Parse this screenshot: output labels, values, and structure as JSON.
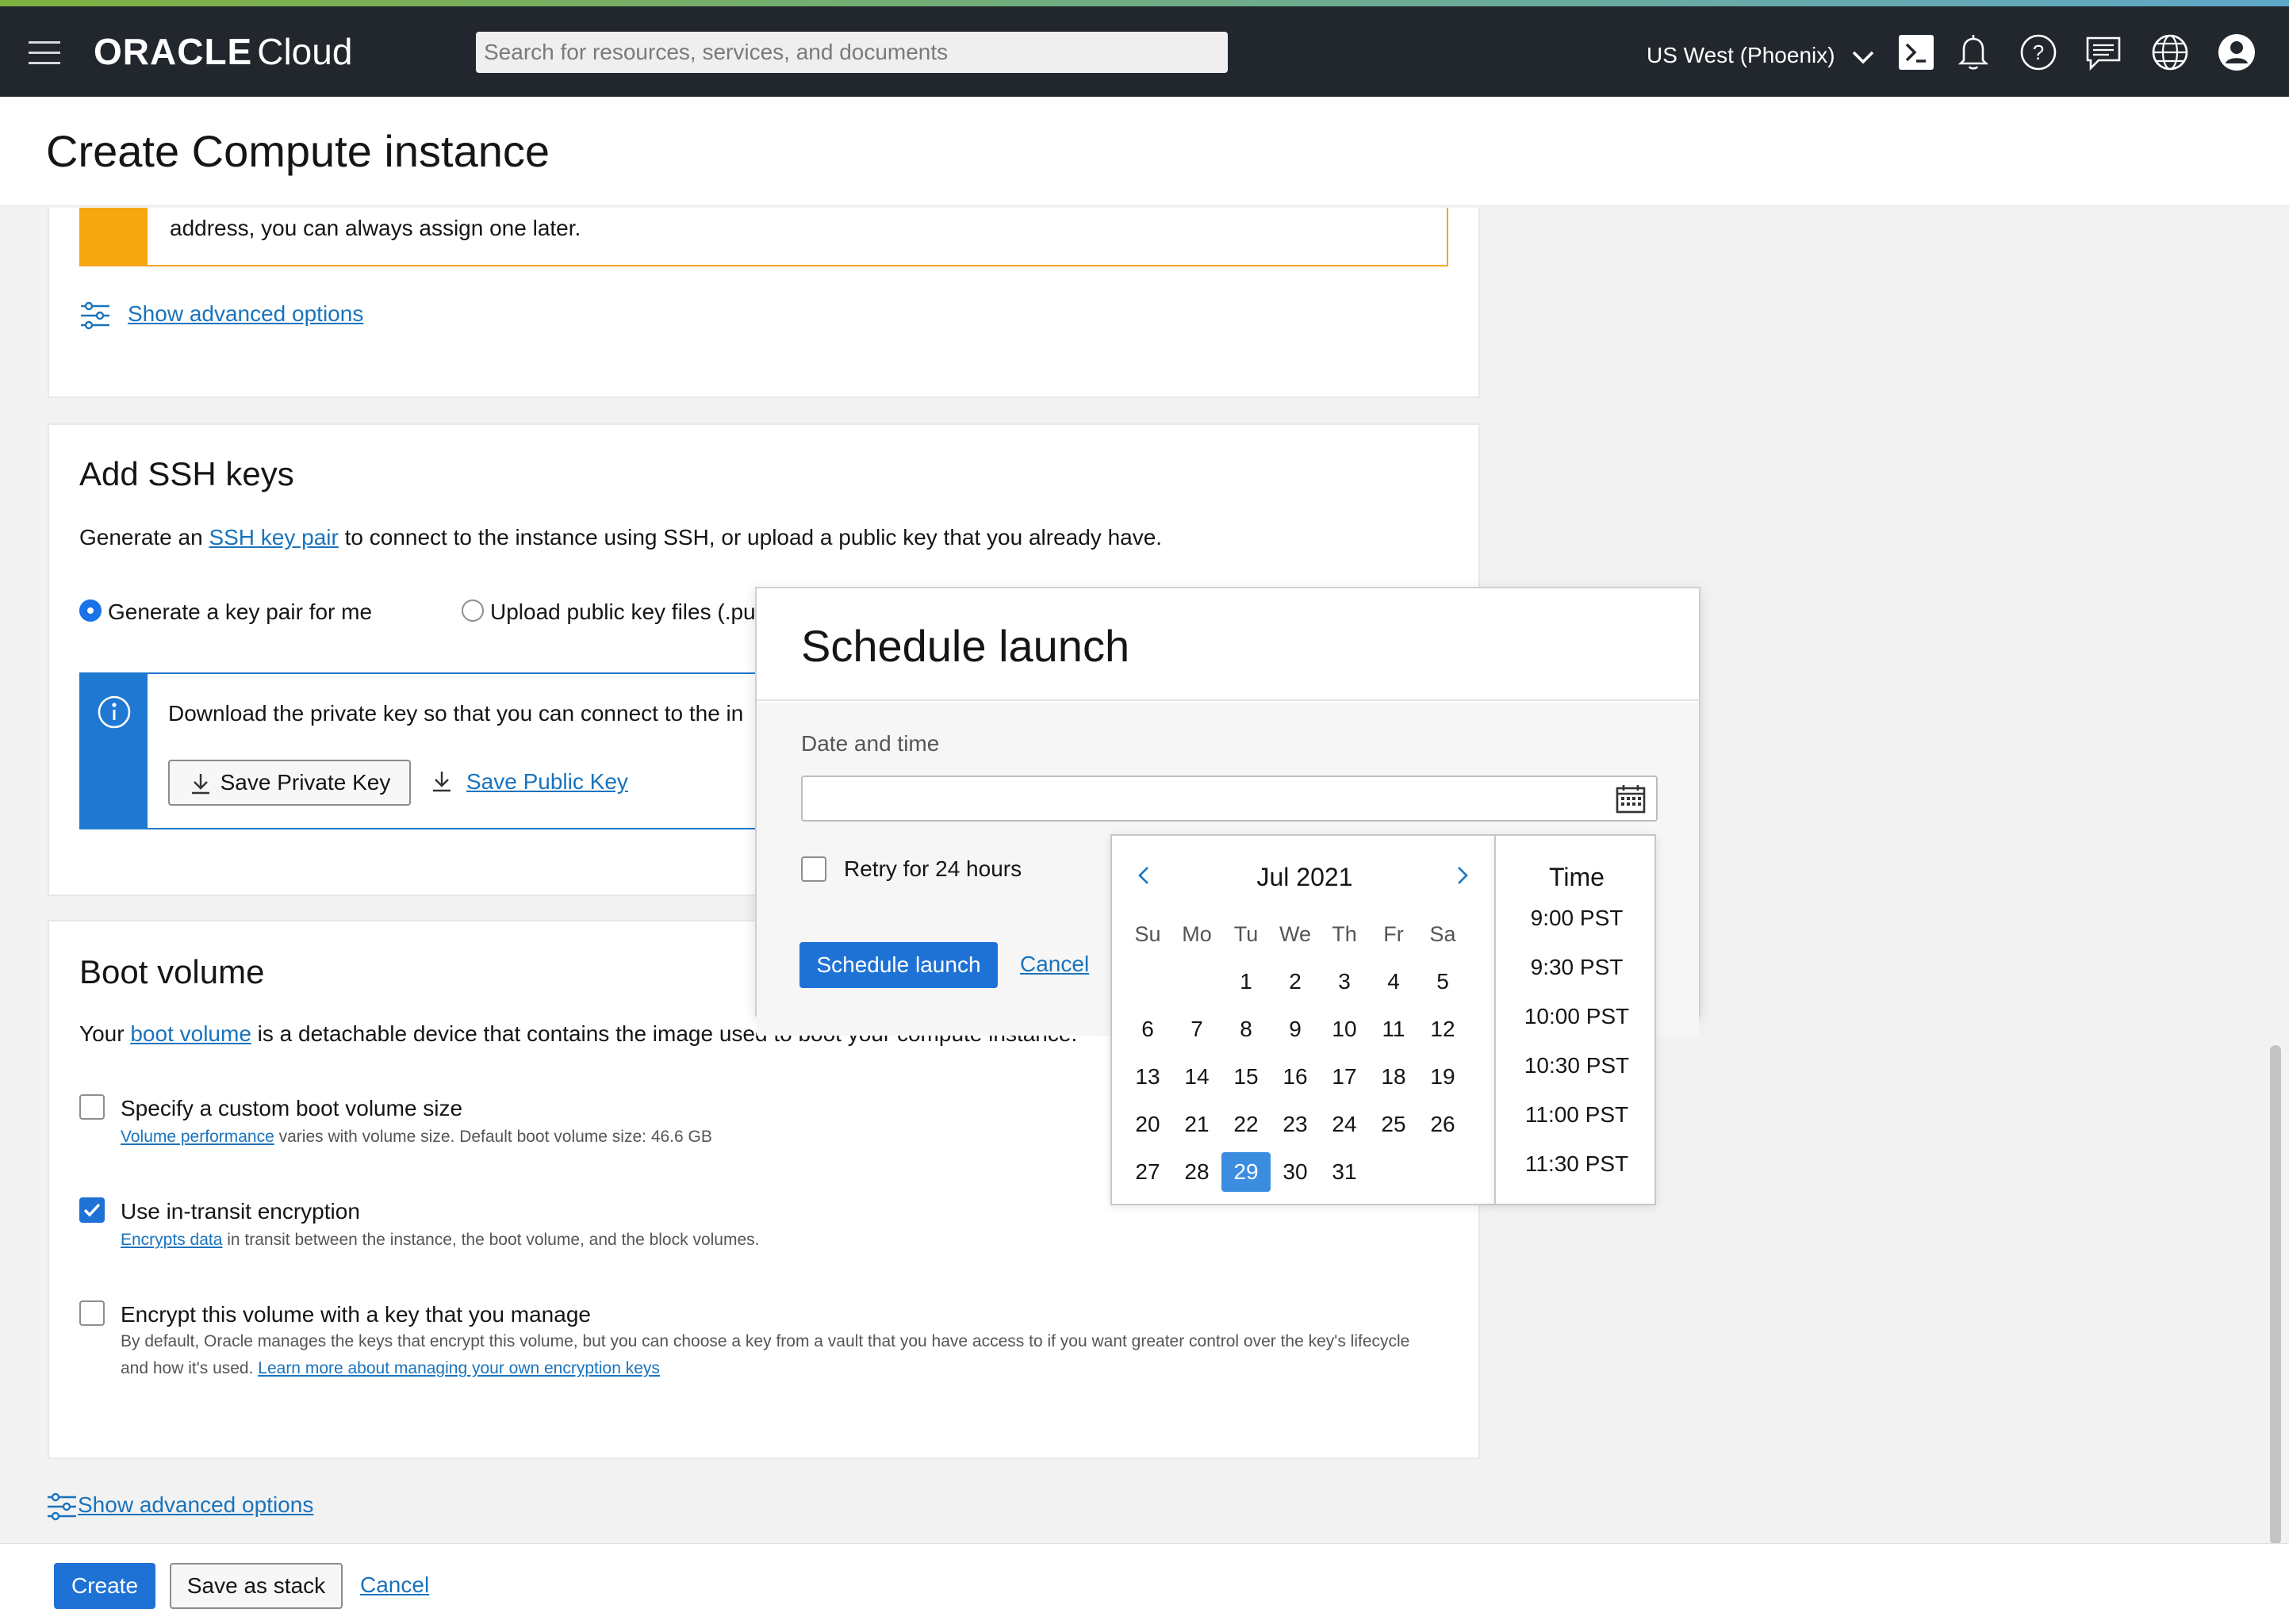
{
  "topnav": {
    "logo_brand": "ORACLE",
    "logo_product": "Cloud",
    "search_placeholder": "Search for resources, services, and documents",
    "region": "US West (Phoenix)"
  },
  "page": {
    "title": "Create Compute instance"
  },
  "networking": {
    "warning_text": "address, you can always assign one later.",
    "advanced_link": "Show advanced options"
  },
  "ssh": {
    "title": "Add SSH keys",
    "desc_prefix": "Generate an ",
    "desc_link": "SSH key pair",
    "desc_suffix": " to connect to the instance using SSH, or upload a public key that you already have.",
    "options": [
      "Generate a key pair for me",
      "Upload public key files (.pu"
    ],
    "info_text": "Download the private key so that you can connect to the in",
    "save_private": "Save Private Key",
    "save_public": "Save Public Key"
  },
  "boot": {
    "title": "Boot volume",
    "desc_prefix": "Your ",
    "desc_link": "boot volume",
    "desc_suffix": " is a detachable device that contains the image used to boot your compute instance.",
    "custom_size_label": "Specify a custom boot volume size",
    "custom_size_link": "Volume performance",
    "custom_size_help": " varies with volume size. Default boot volume size: 46.6 GB",
    "transit_label": "Use in-transit encryption",
    "transit_link": "Encrypts data",
    "transit_help": " in transit between the instance, the boot volume, and the block volumes.",
    "encrypt_label": "Encrypt this volume with a key that you manage",
    "encrypt_help1": "By default, Oracle manages the keys that encrypt this volume, but you can choose a key from a vault that you have access to if you want greater control over the key's lifecycle",
    "encrypt_help2": "and how it's used. ",
    "encrypt_link": "Learn more about managing your own encryption keys",
    "advanced_link": "Show advanced options"
  },
  "footer": {
    "create": "Create",
    "save_stack": "Save as stack",
    "cancel": "Cancel"
  },
  "dialog": {
    "title": "Schedule launch",
    "date_label": "Date and time",
    "date_value": "",
    "retry_label": "Retry for 24 hours",
    "schedule_button": "Schedule launch",
    "cancel": "Cancel"
  },
  "calendar": {
    "month": "Jul 2021",
    "weekdays": [
      "Su",
      "Mo",
      "Tu",
      "We",
      "Th",
      "Fr",
      "Sa"
    ],
    "weeks": [
      [
        "",
        "",
        "1",
        "2",
        "3",
        "4",
        "5"
      ],
      [
        "6",
        "7",
        "8",
        "9",
        "10",
        "11",
        "12"
      ],
      [
        "13",
        "14",
        "15",
        "16",
        "17",
        "18",
        "19"
      ],
      [
        "20",
        "21",
        "22",
        "23",
        "24",
        "25",
        "26"
      ],
      [
        "27",
        "28",
        "29",
        "30",
        "31",
        "",
        ""
      ]
    ],
    "selected_day": "29",
    "time_title": "Time",
    "times": [
      "9:00 PST",
      "9:30 PST",
      "10:00 PST",
      "10:30 PST",
      "11:00 PST",
      "11:30 PST"
    ]
  },
  "icons": [
    "menu-icon",
    "cloud-shell-icon",
    "bell-icon",
    "help-icon",
    "chat-icon",
    "globe-icon",
    "user-icon",
    "calendar-icon",
    "download-icon",
    "info-icon",
    "sliders-icon",
    "chevron-down-icon",
    "chevron-left-icon",
    "chevron-right-icon",
    "check-icon"
  ],
  "colors": {
    "accent": "#1f72d5",
    "warning": "#f6a70f",
    "info": "#1f78d1",
    "nav_bg": "#22272e"
  }
}
